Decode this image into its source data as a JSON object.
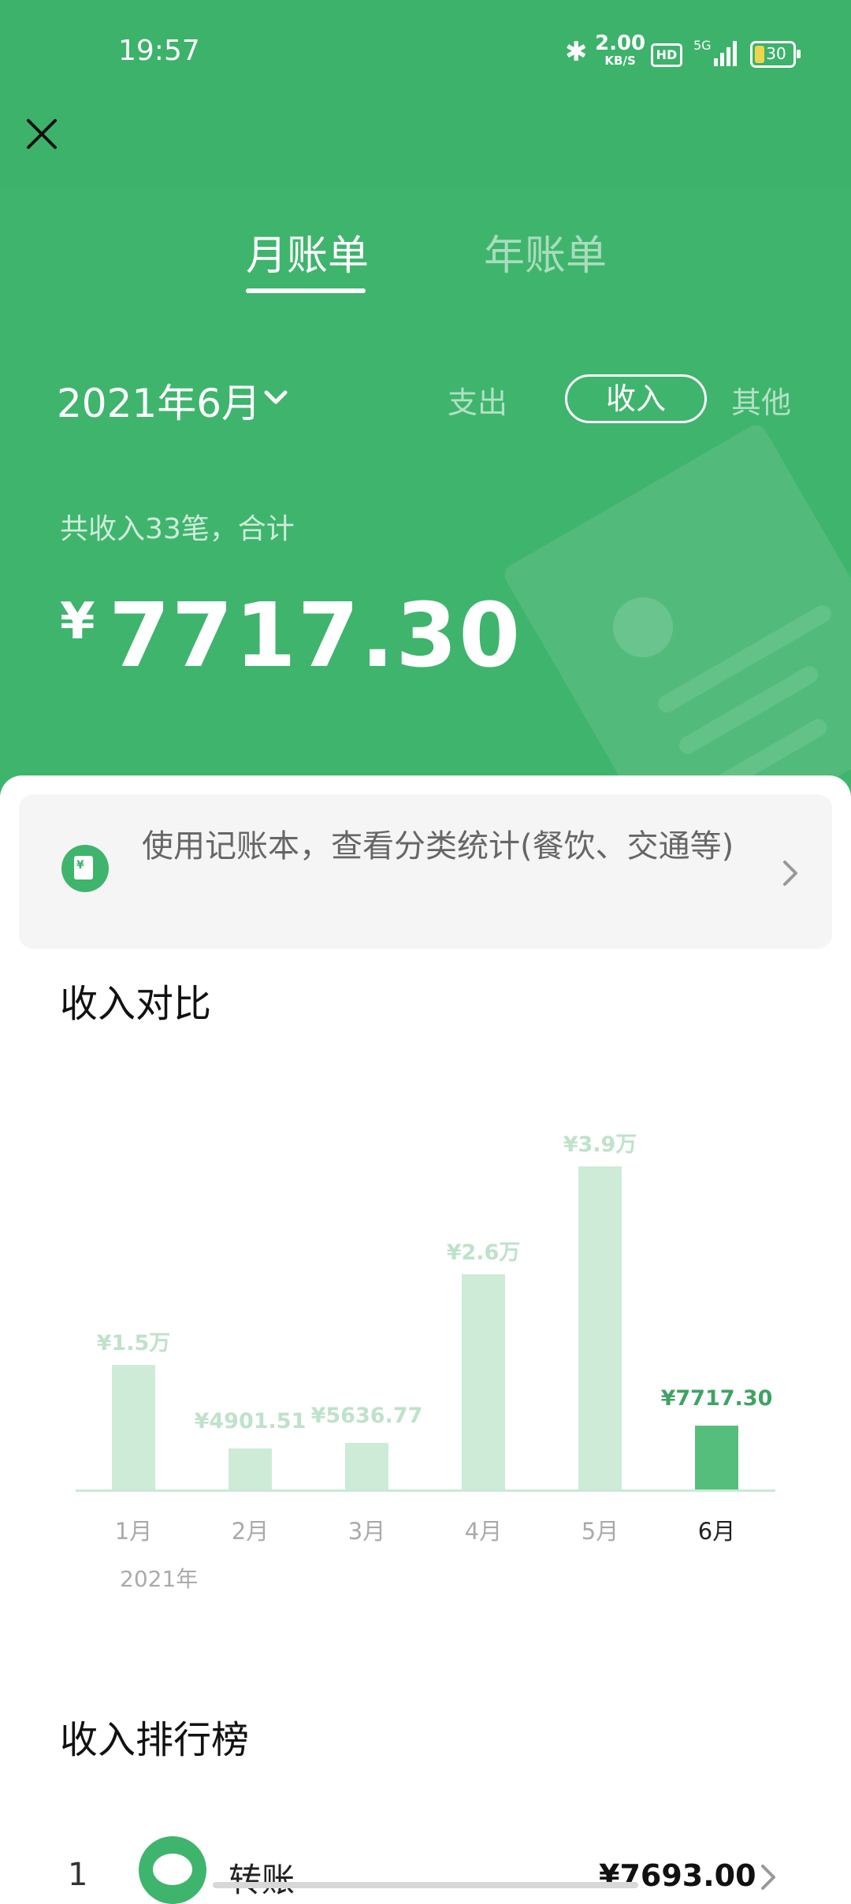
{
  "status_bar": {
    "time": "19:57",
    "speed": "2.00",
    "speed_unit": "KB/S",
    "hd": "HD",
    "network": "5G",
    "battery": "30"
  },
  "tabs": [
    {
      "label": "月账单",
      "active": true
    },
    {
      "label": "年账单",
      "active": false
    }
  ],
  "header": {
    "date": "2021年6月",
    "filters": [
      {
        "label": "支出"
      },
      {
        "label": "收入",
        "selected": true
      },
      {
        "label": "其他"
      }
    ],
    "summary": "共收入33笔，合计",
    "currency": "¥",
    "total": "7717.30"
  },
  "banner": {
    "text": "使用记账本，查看分类统计(餐饮、交通等)"
  },
  "comparison": {
    "title": "收入对比",
    "year_label": "2021年"
  },
  "chart_data": {
    "type": "bar",
    "categories": [
      "1月",
      "2月",
      "3月",
      "4月",
      "5月",
      "6月"
    ],
    "values": [
      15000,
      4901.51,
      5636.77,
      26000,
      39000,
      7717.3
    ],
    "value_labels": [
      "¥1.5万",
      "¥4901.51",
      "¥5636.77",
      "¥2.6万",
      "¥3.9万",
      "¥7717.30"
    ],
    "highlighted_index": 5,
    "colors": {
      "bar": "#cdebd7",
      "bar_active": "#56be7c",
      "label": "#bfe2ca",
      "label_active": "#3fa363"
    }
  },
  "ranking": {
    "title": "收入排行榜",
    "items": [
      {
        "rank": "1",
        "name": "转账",
        "amount": "¥7693.00"
      }
    ]
  },
  "colors": {
    "primary_green": "#3fb46d"
  }
}
